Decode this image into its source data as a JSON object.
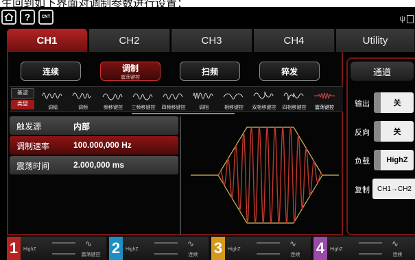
{
  "caption": "生回到如下界面对调制参数进行设置：",
  "topbar": {
    "home_icon": "house-icon",
    "help_label": "?",
    "counter_label": "CNT"
  },
  "colors": {
    "accent": "#b52323",
    "channel1": "#b52323",
    "channel2": "#1e8fc4",
    "channel3": "#d59a1b",
    "channel4": "#9a4aa8"
  },
  "tabs": [
    {
      "label": "CH1",
      "active": true
    },
    {
      "label": "CH2"
    },
    {
      "label": "CH3"
    },
    {
      "label": "CH4"
    },
    {
      "label": "Utility"
    }
  ],
  "modes": [
    {
      "label": "连续"
    },
    {
      "label": "调制",
      "sub": "震荡键控",
      "active": true
    },
    {
      "label": "扫频"
    },
    {
      "label": "猝发"
    }
  ],
  "type_strip": {
    "base_label": "基波",
    "type_label": "类型",
    "items": [
      {
        "label": "调幅",
        "icon": "am-wave-icon"
      },
      {
        "label": "调频",
        "icon": "fm-wave-icon"
      },
      {
        "label": "频移键控",
        "icon": "fsk-wave-icon"
      },
      {
        "label": "三频移键控",
        "icon": "3fsk-wave-icon"
      },
      {
        "label": "四频移键控",
        "icon": "4fsk-wave-icon"
      },
      {
        "label": "调相",
        "icon": "pm-wave-icon"
      },
      {
        "label": "相移键控",
        "icon": "psk-wave-icon"
      },
      {
        "label": "双相移键控",
        "icon": "bpsk-wave-icon"
      },
      {
        "label": "四相移键控",
        "icon": "qpsk-wave-icon"
      },
      {
        "label": "震荡键控",
        "icon": "osk-wave-icon",
        "selected": true
      }
    ]
  },
  "params": [
    {
      "label": "触发源",
      "value": "内部"
    },
    {
      "label": "调制速率",
      "value": "100.000,000 Hz",
      "active": true
    },
    {
      "label": "震荡时间",
      "value": "2.000,000 ms"
    }
  ],
  "side": {
    "title": "通道",
    "rows": [
      {
        "label": "输出",
        "value": "关"
      },
      {
        "label": "反向",
        "value": "关"
      },
      {
        "label": "负载",
        "value": "HighZ"
      },
      {
        "label": "复制",
        "value": "CH1→CH2"
      }
    ]
  },
  "bottom_channels": [
    {
      "num": "1",
      "impedance": "HighZ",
      "mode": "震荡键控"
    },
    {
      "num": "2",
      "impedance": "HighZ",
      "mode": "连续"
    },
    {
      "num": "3",
      "impedance": "HighZ",
      "mode": "连续"
    },
    {
      "num": "4",
      "impedance": "HighZ",
      "mode": "连续"
    }
  ]
}
